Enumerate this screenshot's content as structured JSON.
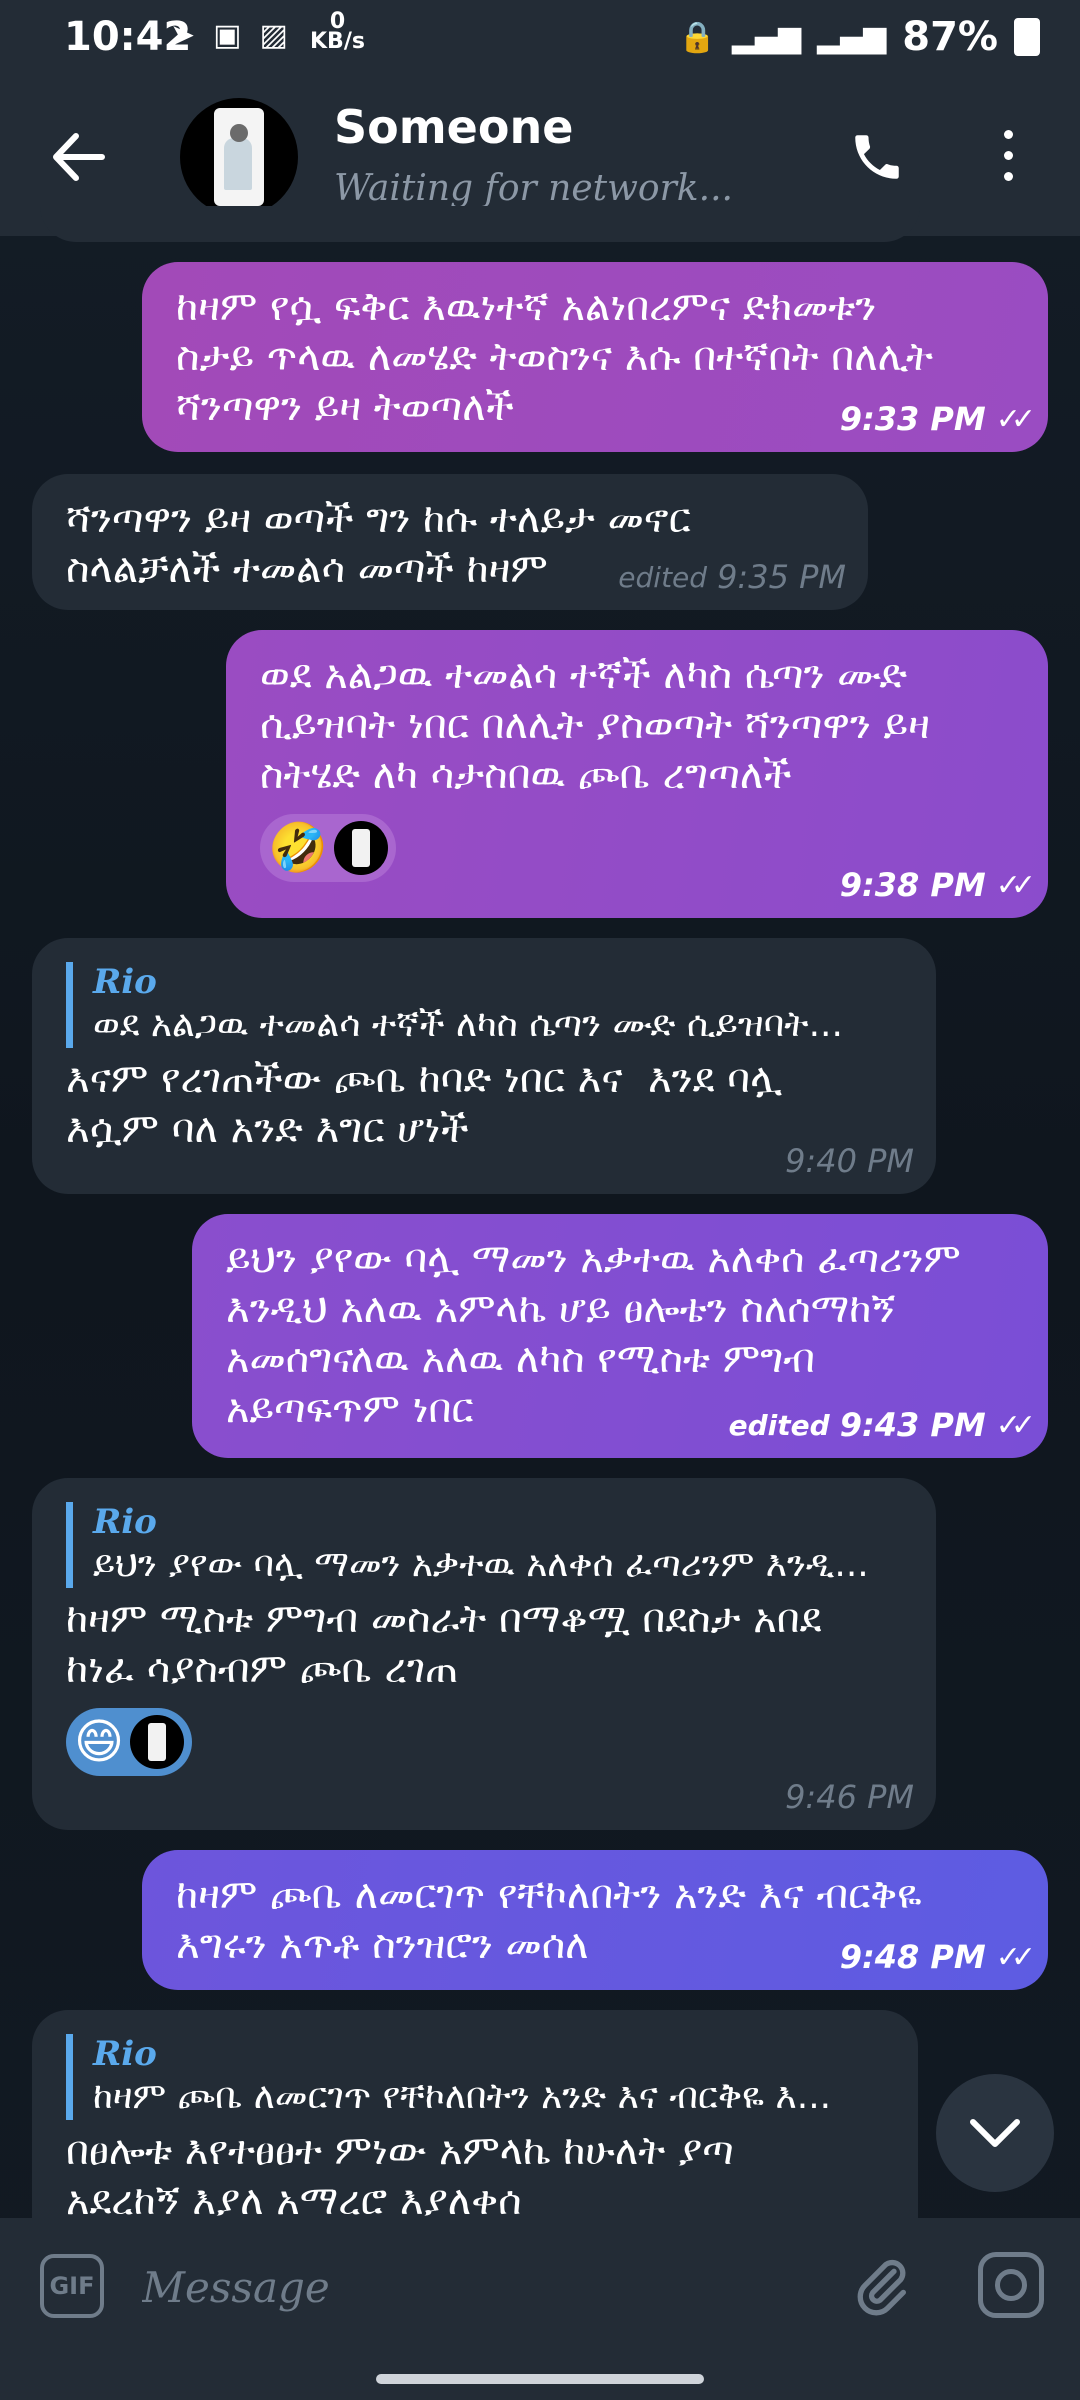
{
  "status_bar": {
    "time": "10:42",
    "netspeed_value": "0",
    "netspeed_unit": "KB/s",
    "battery": "87%"
  },
  "header": {
    "name": "Someone",
    "status": "Waiting for network..."
  },
  "messages": [
    {
      "direction": "out",
      "text": "ከዛም የሷ ፍቅር እዉነተኛ አልነበረምና ድክመቱን\nስታይ ጥላዉ ለመሄድ ትወስንና እሱ በተኛበት በለሊት\nሻንጣዋን ይዛ ትወጣለች",
      "time": "9:33 PM"
    },
    {
      "direction": "in",
      "text": "ሻንጣዋን ይዛ ወጣች ግን ከሱ ተለይታ መኖር\nስላልቻለች ተመልሳ መጣች ከዛም",
      "edited": "edited",
      "time": "9:35 PM"
    },
    {
      "direction": "out",
      "text": "ወደ አልጋዉ ተመልሳ ተኛች ለካስ ሴጣን ሙድ\nሲይዝባት ነበር በለሊት ያስወጣት ሻንጣዋን ይዛ\nስትሄድ ለካ ሳታስበዉ ጮቤ ረግጣለች",
      "reaction": "🤣",
      "time": "9:38 PM"
    },
    {
      "direction": "in",
      "reply_name": "Rio",
      "reply_text": "ወደ አልጋዉ ተመልሳ ተኛች ለካስ ሴጣን ሙድ ሲይዝባት...",
      "text": "እናም የረገጠችው ጮቤ ከባድ ነበር እና  እንደ ባሏ\nእሷም ባለ አንድ እግር ሆነች",
      "time": "9:40 PM"
    },
    {
      "direction": "out",
      "text": "ይህን ያየው ባሏ ማመን አቃተዉ አለቀሰ ፈጣሪንም\nእንዲህ አለዉ አምላኬ ሆይ ፀሎቴን ስለሰማከኝ\nአመሰግናለዉ አለዉ ለካስ የሚስቱ ምግብ\nአይጣፍጥም ነበር",
      "edited": "edited",
      "time": "9:43 PM"
    },
    {
      "direction": "in",
      "reply_name": "Rio",
      "reply_text": "ይህን ያየው ባሏ ማመን አቃተዉ አለቀሰ ፈጣሪንም እንዲ...",
      "text": "ከዛም ሚስቱ ምግብ መስራት በማቆሟ በደስታ አበደ\nከነፈ ሳያስብም ጮቤ ረገጠ",
      "reaction": "😄",
      "time": "9:46 PM"
    },
    {
      "direction": "out",
      "text": "ከዛም ጮቤ ለመርገጥ የቸኮለበትን አንድ እና ብርቅዬ\nእግሩን አጥቶ ስንዝሮን መሰለ",
      "time": "9:48 PM"
    },
    {
      "direction": "in",
      "reply_name": "Rio",
      "reply_text": "ከዛም ጮቤ ለመርገጥ የቸኮለበትን አንድ እና ብርቅዬ እ...",
      "text": "በፀሎቱ እየተፀፀተ ምነው አምላኬ ከሁለት ያጣ\nአደረከኝ እያለ አማረሮ እያለቀሰ"
    }
  ],
  "composer": {
    "gif_label": "GIF",
    "placeholder": "Message"
  },
  "colors": {
    "out_gradient": [
      "#a24ab8",
      "#7a4ed6",
      "#5d5ce2"
    ],
    "incoming_bubble": "#232c36",
    "reply_accent": "#5aa9ec",
    "header_bg": "#232c36"
  }
}
